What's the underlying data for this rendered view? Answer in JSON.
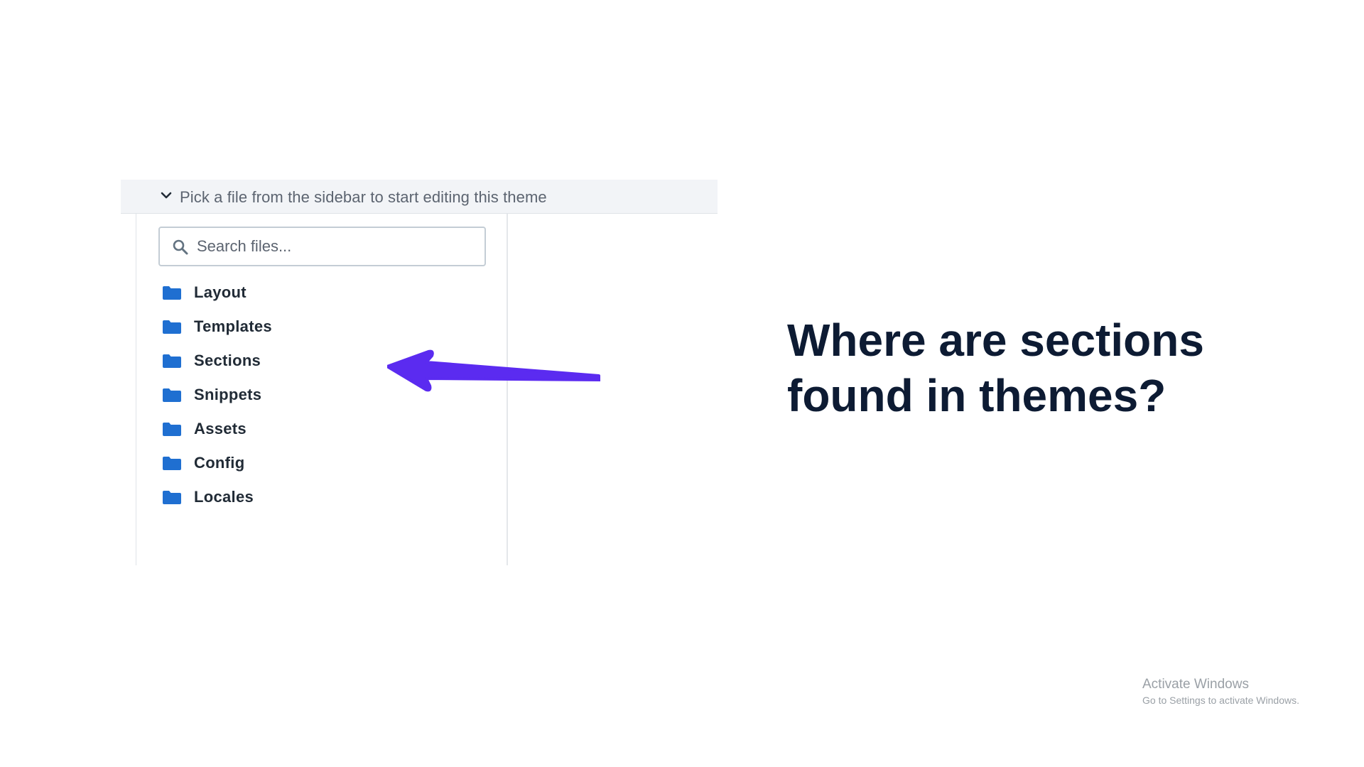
{
  "editor": {
    "header_text": "Pick a file from the sidebar to start editing this theme",
    "search": {
      "placeholder": "Search files...",
      "value": ""
    },
    "folders": [
      {
        "label": "Layout",
        "icon": "folder-icon"
      },
      {
        "label": "Templates",
        "icon": "folder-icon"
      },
      {
        "label": "Sections",
        "icon": "folder-icon"
      },
      {
        "label": "Snippets",
        "icon": "folder-icon"
      },
      {
        "label": "Assets",
        "icon": "folder-icon"
      },
      {
        "label": "Config",
        "icon": "folder-icon"
      },
      {
        "label": "Locales",
        "icon": "folder-icon"
      }
    ],
    "highlighted_folder": "Sections"
  },
  "question": {
    "line1": "Where are sections",
    "line2": "found in themes?"
  },
  "watermark": {
    "title": "Activate Windows",
    "subtitle": "Go to Settings to activate Windows."
  },
  "colors": {
    "folder": "#1f6fd1",
    "arrow": "#5b2bf0",
    "heading": "#0d1b33",
    "header_bg": "#f2f4f7"
  }
}
